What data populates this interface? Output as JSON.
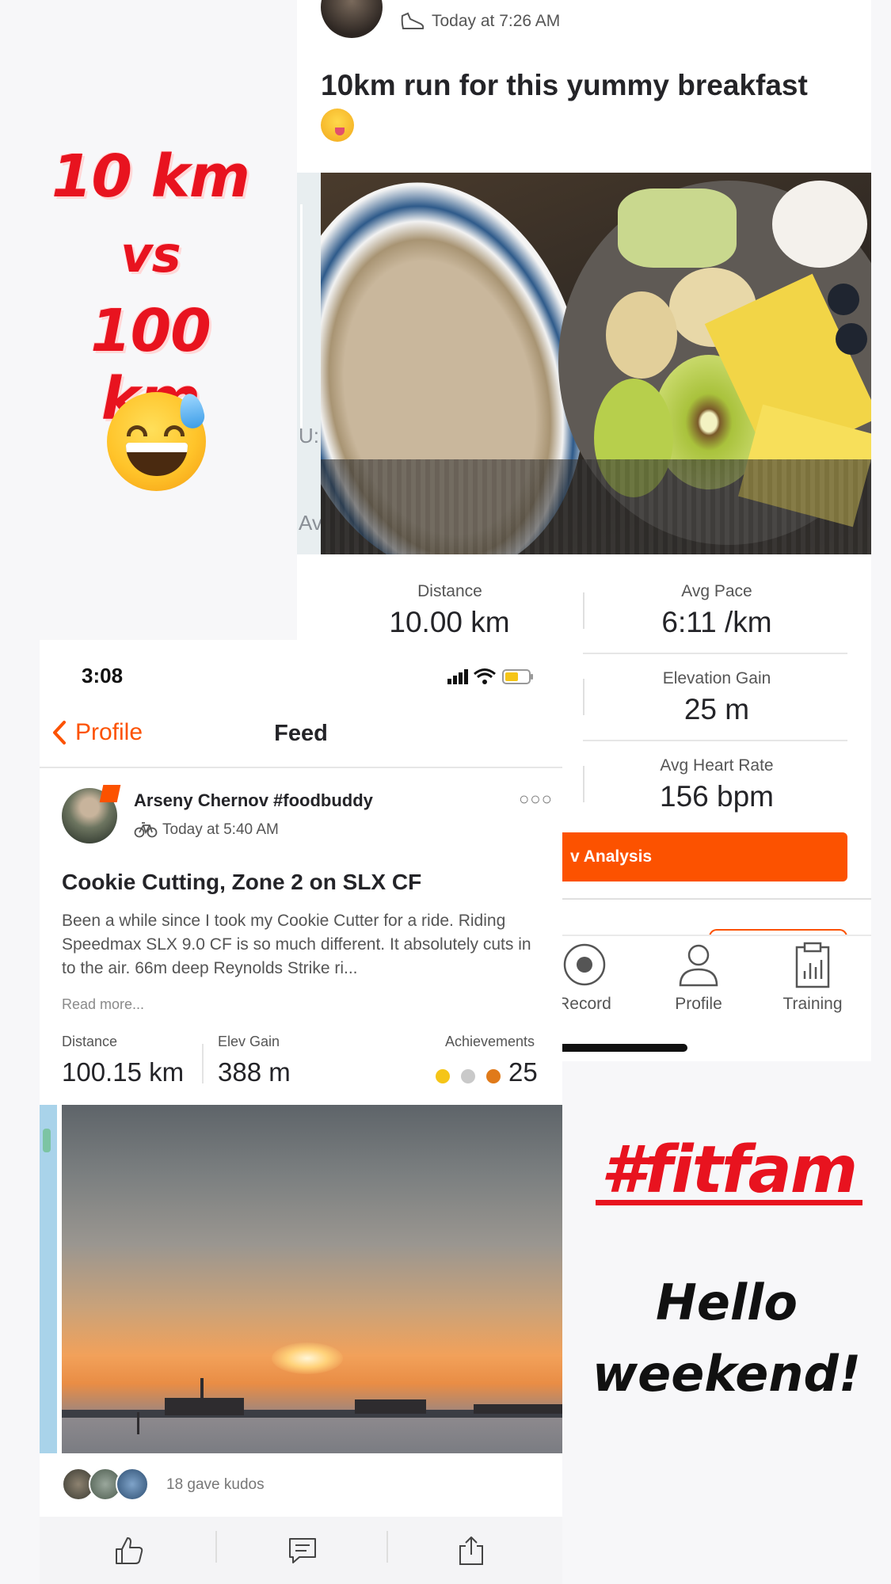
{
  "background_post": {
    "time": "Today at 7:26 AM",
    "title": "10km run for this yummy breakfast",
    "map_fragments": [
      "U:",
      "Av"
    ],
    "stats": [
      {
        "label": "Distance",
        "value": "10.00 km"
      },
      {
        "label": "Avg Pace",
        "value": "6:11 /km"
      },
      {
        "label": "Elevation Gain",
        "value": "25 m"
      },
      {
        "label": "Avg Heart Rate",
        "value": "156 bpm"
      }
    ],
    "analysis_button": "v Analysis",
    "tabs": [
      {
        "label": "Record",
        "icon": "record-icon"
      },
      {
        "label": "Profile",
        "icon": "profile-icon"
      },
      {
        "label": "Training",
        "icon": "training-icon"
      }
    ]
  },
  "overlay": {
    "line1": "10 km",
    "line2": "vs",
    "line3": "100 km",
    "hashtag": "#fitfam",
    "hello_line1": "Hello",
    "hello_line2": "weekend!",
    "accent_red": "#e8131f"
  },
  "feed": {
    "status_time": "3:08",
    "back_label": "Profile",
    "nav_title": "Feed",
    "athlete_name": "Arseny Chernov #foodbuddy",
    "activity_time": "Today at 5:40 AM",
    "activity_title": "Cookie Cutting, Zone 2 on SLX CF",
    "description": "Been a while since I took my Cookie Cutter for a ride. Riding Speedmax SLX 9.0 CF is so much different. It absolutely cuts in to the air. 66m deep Reynolds Strike ri...",
    "read_more": "Read more...",
    "stats": [
      {
        "label": "Distance",
        "value": "100.15 km"
      },
      {
        "label": "Elev Gain",
        "value": "388 m"
      },
      {
        "label": "Achievements",
        "value": "25"
      }
    ],
    "kudos_text": "18 gave kudos",
    "brand_orange": "#fc5200"
  }
}
